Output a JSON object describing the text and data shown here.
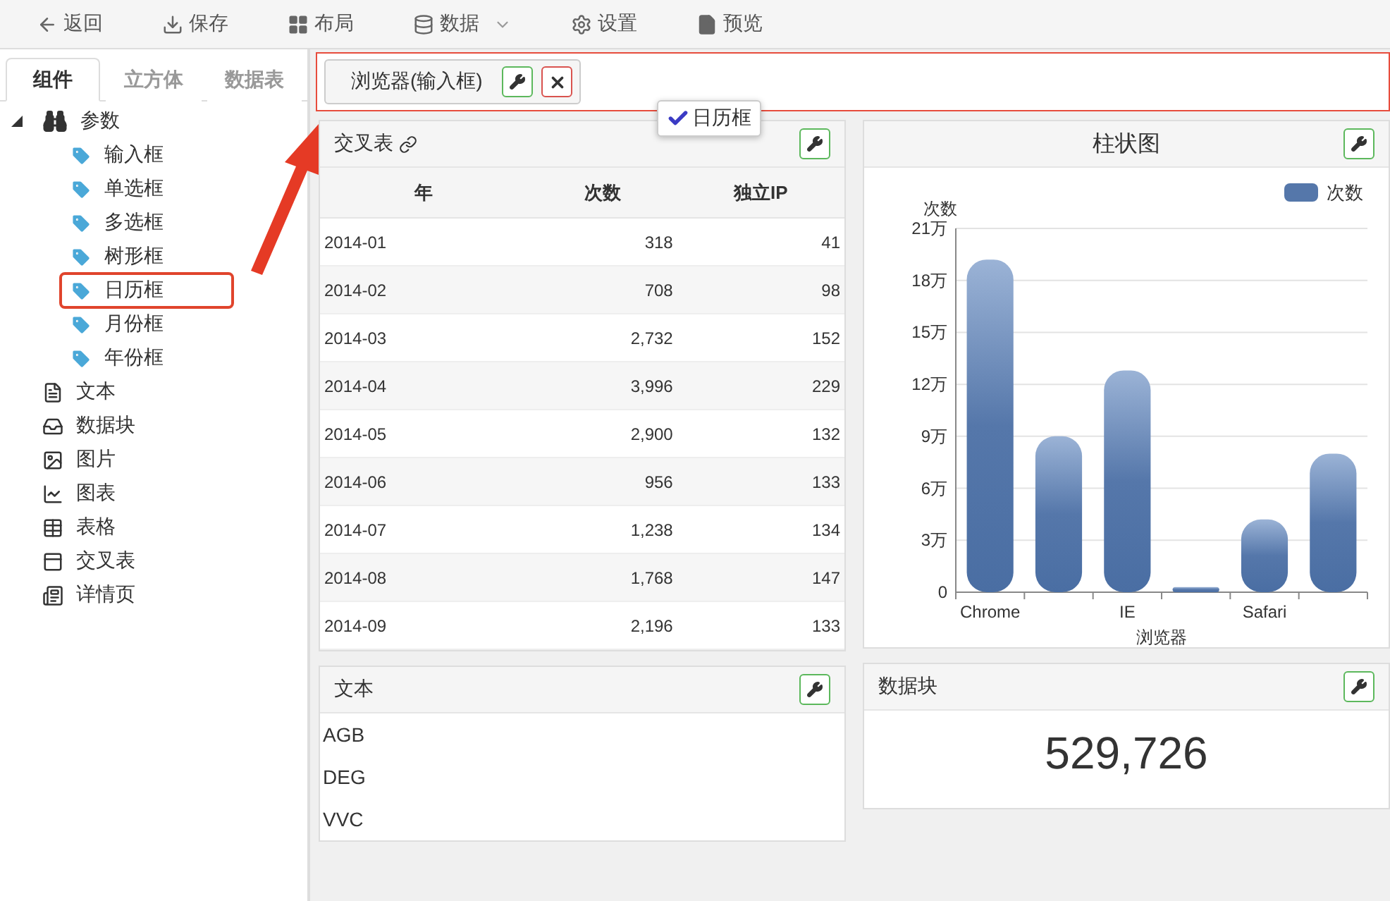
{
  "toolbar": [
    {
      "kind": "back",
      "label": "返回"
    },
    {
      "kind": "save",
      "label": "保存"
    },
    {
      "kind": "layout",
      "label": "布局"
    },
    {
      "kind": "data",
      "label": "数据",
      "dropdown": true
    },
    {
      "kind": "settings",
      "label": "设置"
    },
    {
      "kind": "preview",
      "label": "预览"
    }
  ],
  "sidebar": {
    "tabs": [
      {
        "label": "组件",
        "selected": true
      },
      {
        "label": "立方体",
        "selected": false
      },
      {
        "label": "数据表",
        "selected": false
      }
    ],
    "tree": [
      {
        "kind": "params",
        "label": "参数",
        "expanded": true,
        "children": [
          {
            "kind": "tag",
            "label": "输入框",
            "highlighted": false
          },
          {
            "kind": "tag",
            "label": "单选框",
            "highlighted": false
          },
          {
            "kind": "tag",
            "label": "多选框",
            "highlighted": false
          },
          {
            "kind": "tag",
            "label": "树形框",
            "highlighted": false
          },
          {
            "kind": "tag",
            "label": "日历框",
            "highlighted": true
          },
          {
            "kind": "tag",
            "label": "月份框",
            "highlighted": false
          },
          {
            "kind": "tag",
            "label": "年份框",
            "highlighted": false
          }
        ]
      },
      {
        "kind": "text",
        "label": "文本"
      },
      {
        "kind": "datablock",
        "label": "数据块"
      },
      {
        "kind": "image",
        "label": "图片"
      },
      {
        "kind": "chart",
        "label": "图表"
      },
      {
        "kind": "table",
        "label": "表格"
      },
      {
        "kind": "crosstab",
        "label": "交叉表"
      },
      {
        "kind": "detail",
        "label": "详情页"
      }
    ]
  },
  "param_bar": {
    "chips": [
      {
        "label": "浏览器(输入框)"
      }
    ],
    "drag_tooltip": "日历框"
  },
  "crosstab": {
    "title": "交叉表",
    "columns": [
      "年",
      "次数",
      "独立IP"
    ],
    "rows": [
      [
        "2014-01",
        "318",
        "41"
      ],
      [
        "2014-02",
        "708",
        "98"
      ],
      [
        "2014-03",
        "2,732",
        "152"
      ],
      [
        "2014-04",
        "3,996",
        "229"
      ],
      [
        "2014-05",
        "2,900",
        "132"
      ],
      [
        "2014-06",
        "956",
        "133"
      ],
      [
        "2014-07",
        "1,238",
        "134"
      ],
      [
        "2014-08",
        "1,768",
        "147"
      ],
      [
        "2014-09",
        "2,196",
        "133"
      ]
    ]
  },
  "text_panel": {
    "title": "文本",
    "lines": [
      "AGB",
      "DEG",
      "VVC"
    ]
  },
  "bar_chart": {
    "title": "柱状图",
    "chart_data": {
      "type": "bar",
      "xlabel": "浏览器",
      "ylabel": "次数",
      "categories": [
        "Chrome",
        null,
        "IE",
        null,
        "Safari",
        null
      ],
      "series": [
        {
          "name": "次数",
          "color": "#5577aa",
          "values": [
            19.2,
            9,
            12.8,
            0.3,
            4.2,
            8
          ]
        }
      ],
      "ylim": [
        0,
        21
      ],
      "grid": true,
      "yticks": [
        {
          "value": 0,
          "label": "0"
        },
        {
          "value": 3,
          "label": "3万"
        },
        {
          "value": 6,
          "label": "6万"
        },
        {
          "value": 9,
          "label": "9万"
        },
        {
          "value": 12,
          "label": "12万"
        },
        {
          "value": 15,
          "label": "15万"
        },
        {
          "value": 18,
          "label": "18万"
        },
        {
          "value": 21,
          "label": "21万"
        }
      ]
    }
  },
  "data_block": {
    "title": "数据块",
    "value": "529,726"
  }
}
